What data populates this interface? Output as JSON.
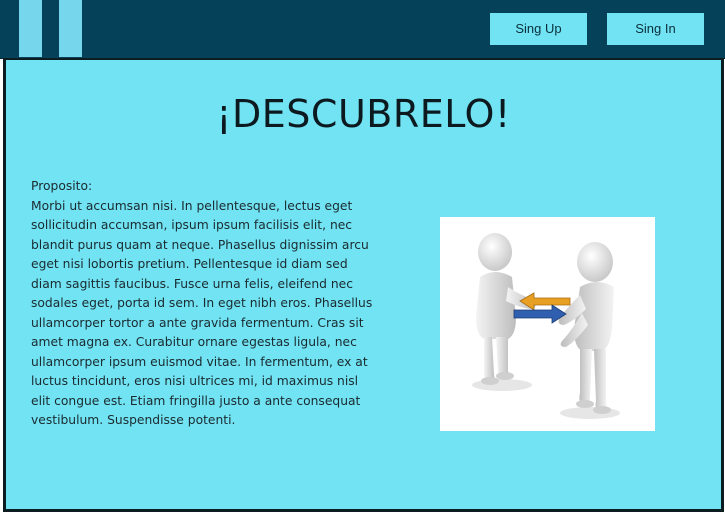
{
  "header": {
    "signup_label": "Sing Up",
    "signin_label": "Sing In"
  },
  "main": {
    "title": "¡DESCUBRELO!",
    "purpose_label": "Proposito:",
    "purpose_text": "Morbi ut accumsan nisi. In pellentesque, lectus eget sollicitudin accumsan, ipsum ipsum facilisis elit, nec blandit purus quam at neque. Phasellus dignissim arcu eget nisi lobortis pretium. Pellentesque id diam sed diam sagittis faucibus. Fusce urna felis, eleifend nec sodales eget, porta id sem. In eget nibh eros. Phasellus ullamcorper tortor a ante gravida fermentum. Cras sit amet magna ex. Curabitur ornare egestas ligula, nec ullamcorper ipsum euismod vitae. In fermentum, ex at luctus tincidunt, eros nisi ultrices mi, id maximus nisl elit congue est. Etiam fringilla justo a ante consequat vestibulum. Suspendisse potenti."
  },
  "image": {
    "icon": "people-exchange-illustration"
  },
  "colors": {
    "header_bg": "#06415a",
    "accent": "#72e3f3",
    "panel_bg": "#72e3f2",
    "arrow_orange": "#e8a024",
    "arrow_blue": "#2f5fae"
  }
}
